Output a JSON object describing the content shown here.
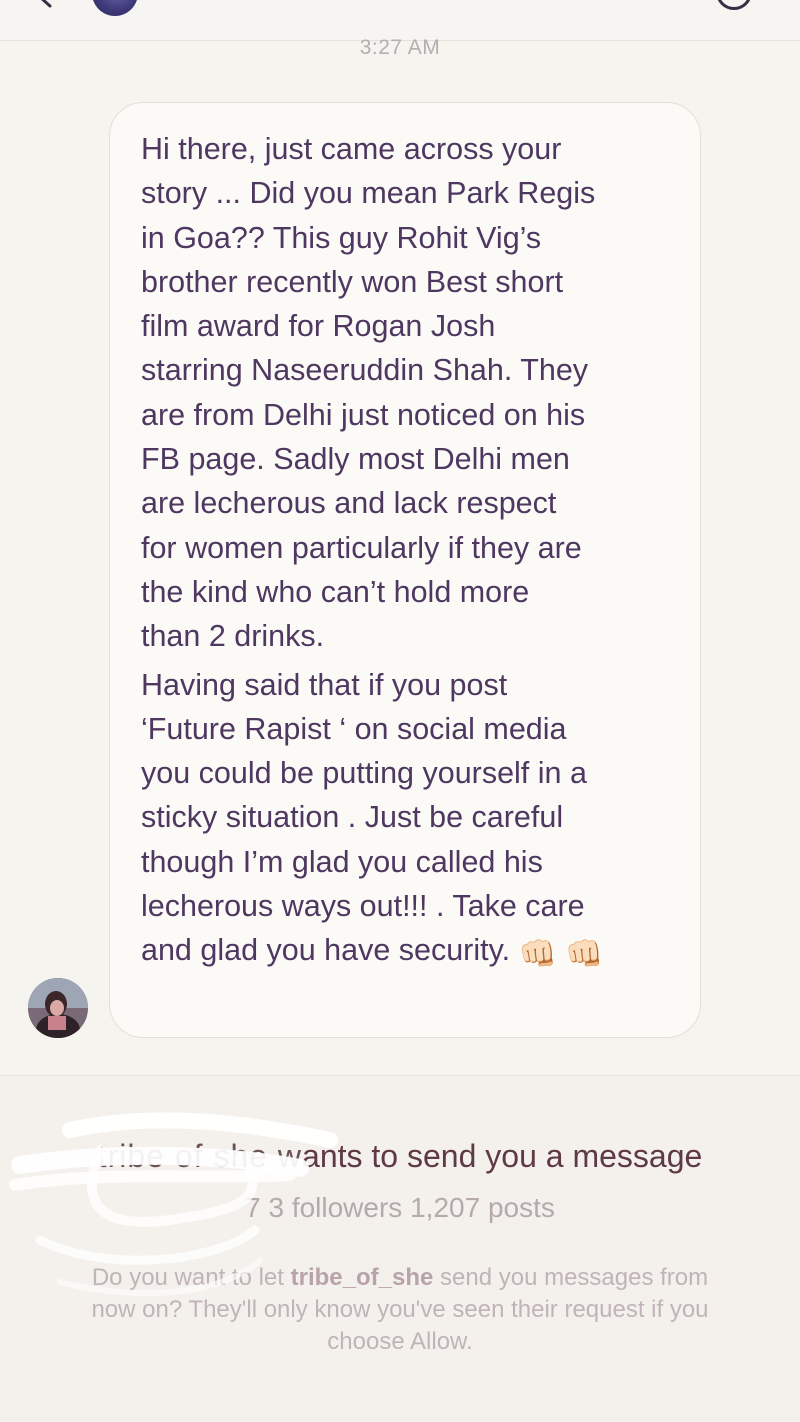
{
  "header": {
    "back_icon": "chevron-left-icon",
    "info_icon": "info-icon"
  },
  "thread": {
    "timestamp": "3:27 AM",
    "message": {
      "paragraph_1": "Hi there, just came across your\nstory ...  Did you mean Park Regis\nin Goa?? This guy Rohit Vig’s\nbrother recently won Best short\nfilm award for Rogan Josh\nstarring Naseeruddin Shah. They\nare from Delhi just noticed on his\nFB page. Sadly most Delhi men\nare lecherous and lack respect\nfor women particularly if they are\nthe kind who can’t hold more\nthan 2 drinks.",
      "paragraph_2": "Having said that if you post\n‘Future Rapist ‘ on social media\nyou could be putting yourself in a\nsticky situation . Just be careful\nthough I’m glad you called his\nlecherous ways out!!! . Take care\nand glad you have security. ",
      "emoji": "👊🏻",
      "emoji_icon": "fist-bump-emoji"
    }
  },
  "request": {
    "title_redacted": "tribe of she w",
    "title": "ants to send you a message",
    "followers_redacted": "7",
    "followers_suffix": "3 followers",
    "posts": "1,207 posts",
    "desc_pre": "Do you want to let ",
    "username": "tribe_of_she",
    "desc_post": " send you messages from now on? They'll only know you've seen their request if you choose Allow."
  },
  "colors": {
    "background": "#f6f4ef",
    "bubble": "#fbfaf6",
    "message_text": "#4e3760",
    "request_title": "#5e3946",
    "muted_text": "#c0b4b8"
  }
}
